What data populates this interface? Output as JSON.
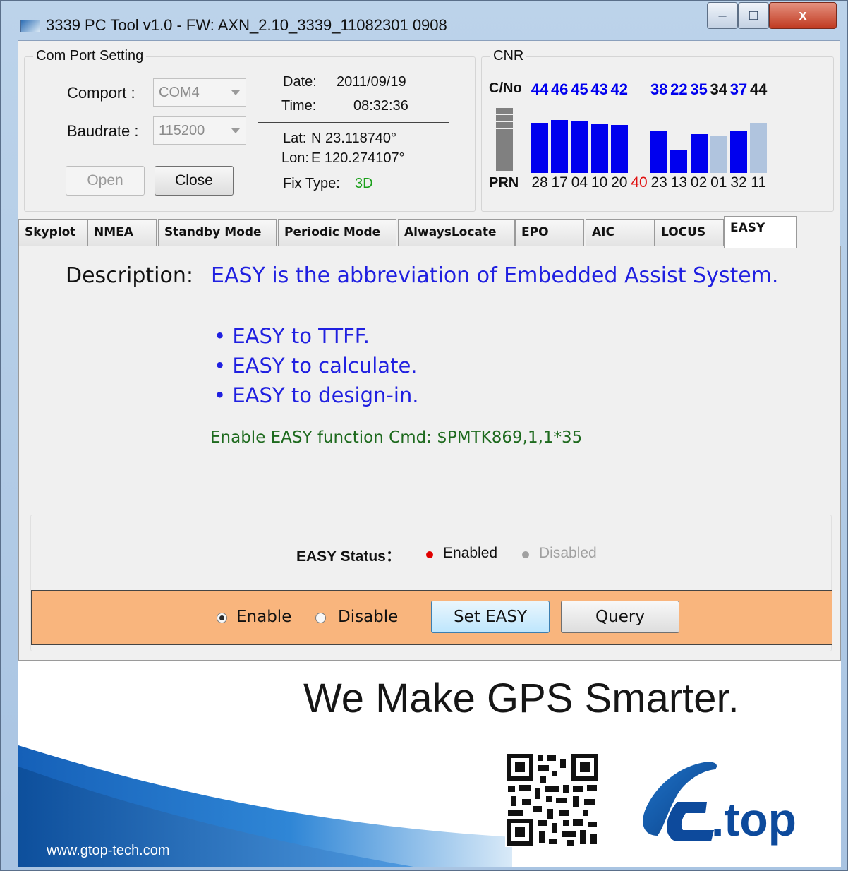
{
  "window": {
    "title": "3339 PC Tool v1.0 - FW: AXN_2.10_3339_11082301 0908",
    "controls": {
      "minimize": "–",
      "maximize": "□",
      "close": "x"
    }
  },
  "com_port": {
    "group_title": "Com Port Setting",
    "comport_label": "Comport :",
    "comport_value": "COM4",
    "baudrate_label": "Baudrate :",
    "baudrate_value": "115200",
    "open_button": "Open",
    "close_button": "Close",
    "date_label": "Date:",
    "date_value": "2011/09/19",
    "time_label": "Time:",
    "time_value": "08:32:36",
    "lat_label": "Lat:",
    "lat_value": "N 23.118740°",
    "lon_label": "Lon:",
    "lon_value": "E 120.274107°",
    "fix_label": "Fix Type:",
    "fix_value": "3D"
  },
  "cnr": {
    "group_title": "CNR",
    "cno_label": "C/No",
    "prn_label": "PRN",
    "satellites": [
      {
        "prn": "28",
        "cno": "44",
        "state": "used"
      },
      {
        "prn": "17",
        "cno": "46",
        "state": "used"
      },
      {
        "prn": "04",
        "cno": "45",
        "state": "used"
      },
      {
        "prn": "10",
        "cno": "43",
        "state": "used"
      },
      {
        "prn": "20",
        "cno": "42",
        "state": "used"
      },
      {
        "prn": "40",
        "cno": "",
        "state": "sbas"
      },
      {
        "prn": "23",
        "cno": "38",
        "state": "used"
      },
      {
        "prn": "13",
        "cno": "22",
        "state": "used"
      },
      {
        "prn": "02",
        "cno": "35",
        "state": "used"
      },
      {
        "prn": "01",
        "cno": "34",
        "state": "tracked"
      },
      {
        "prn": "32",
        "cno": "37",
        "state": "used"
      },
      {
        "prn": "11",
        "cno": "44",
        "state": "tracked"
      }
    ],
    "colors": {
      "used": "#0000ee",
      "tracked": "#b0c4de",
      "sbas_text": "#e01010"
    }
  },
  "tabs": [
    {
      "label": "Skyplot"
    },
    {
      "label": "NMEA"
    },
    {
      "label": "Standby Mode"
    },
    {
      "label": "Periodic Mode"
    },
    {
      "label": "AlwaysLocate"
    },
    {
      "label": "EPO"
    },
    {
      "label": "AIC"
    },
    {
      "label": "LOCUS"
    },
    {
      "label": "EASY",
      "active": true
    }
  ],
  "easy": {
    "description_label": "Description:",
    "description_text": "EASY is the abbreviation of Embedded Assist System.",
    "bullets": [
      "• EASY to TTFF.",
      "• EASY to calculate.",
      "• EASY to design-in."
    ],
    "cmd_text": "Enable EASY function Cmd: $PMTK869,1,1*35",
    "status_label": "EASY Status：",
    "status_enabled": "Enabled",
    "status_disabled": "Disabled",
    "status_current": "Enabled",
    "radio_enable": "Enable",
    "radio_disable": "Disable",
    "radio_selected": "Enable",
    "set_button": "Set EASY",
    "query_button": "Query"
  },
  "banner": {
    "slogan": "We Make GPS Smarter.",
    "url": "www.gtop-tech.com",
    "logo_text": ".top"
  }
}
